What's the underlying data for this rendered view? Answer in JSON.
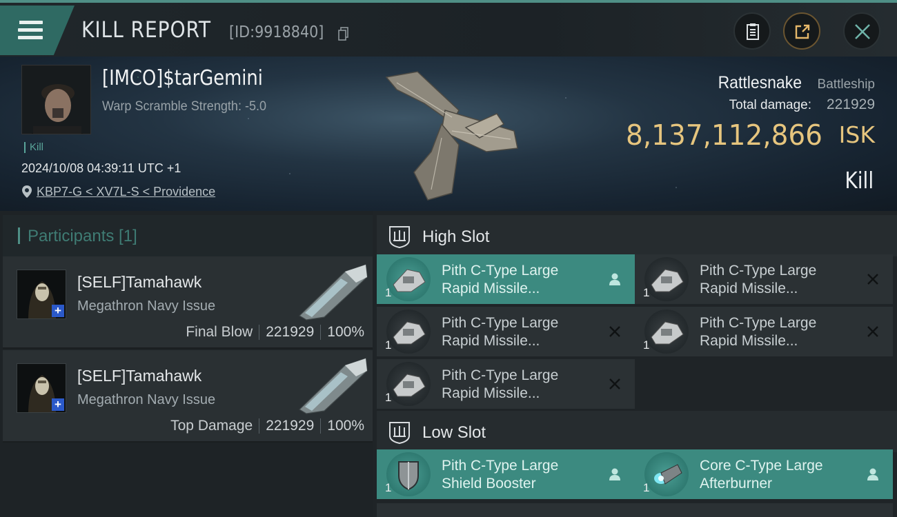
{
  "header": {
    "title": "KILL REPORT",
    "kill_id": "[ID:9918840]",
    "icons": [
      "menu-icon",
      "copy-icon",
      "clipboard-icon",
      "share-icon",
      "close-icon"
    ]
  },
  "victim": {
    "name": "[IMCO]$tarGemini",
    "warp_scramble": "Warp Scramble Strength: -5.0",
    "tag": "Kill",
    "datetime": "2024/10/08 04:39:11 UTC +1",
    "location": "KBP7-G < XV7L-S < Providence",
    "ship_name": "Rattlesnake",
    "ship_class": "Battleship",
    "total_damage_label": "Total damage:",
    "total_damage": "221929",
    "isk_value": "8,137,112,866",
    "isk_unit": "ISK",
    "status": "Kill"
  },
  "participants": {
    "label": "Participants [1]",
    "rows": [
      {
        "name": "[SELF]Tamahawk",
        "ship": "Megathron Navy Issue",
        "role": "Final Blow",
        "damage": "221929",
        "percent": "100%"
      },
      {
        "name": "[SELF]Tamahawk",
        "ship": "Megathron Navy Issue",
        "role": "Top Damage",
        "damage": "221929",
        "percent": "100%"
      }
    ]
  },
  "slots": {
    "high": {
      "label": "High Slot",
      "modules": [
        {
          "line1": "Pith C-Type Large",
          "line2": "Rapid Missile...",
          "qty": "1",
          "flag": "person-icon",
          "active": true
        },
        {
          "line1": "Pith C-Type Large",
          "line2": "Rapid Missile...",
          "qty": "1",
          "flag": "x-icon",
          "active": false
        },
        {
          "line1": "Pith C-Type Large",
          "line2": "Rapid Missile...",
          "qty": "1",
          "flag": "x-icon",
          "active": false
        },
        {
          "line1": "Pith C-Type Large",
          "line2": "Rapid Missile...",
          "qty": "1",
          "flag": "x-icon",
          "active": false
        },
        {
          "line1": "Pith C-Type Large",
          "line2": "Rapid Missile...",
          "qty": "1",
          "flag": "x-icon",
          "active": false
        }
      ]
    },
    "low": {
      "label": "Low Slot",
      "modules": [
        {
          "line1": "Pith C-Type Large",
          "line2": "Shield Booster",
          "qty": "1",
          "flag": "person-icon",
          "active": true
        },
        {
          "line1": "Core C-Type Large",
          "line2": "Afterburner",
          "qty": "1",
          "flag": "person-icon",
          "active": true
        }
      ]
    }
  },
  "colors": {
    "accent": "#3c8a80",
    "isk_gold": "#e6c57e",
    "share_ring": "#6b5530"
  }
}
